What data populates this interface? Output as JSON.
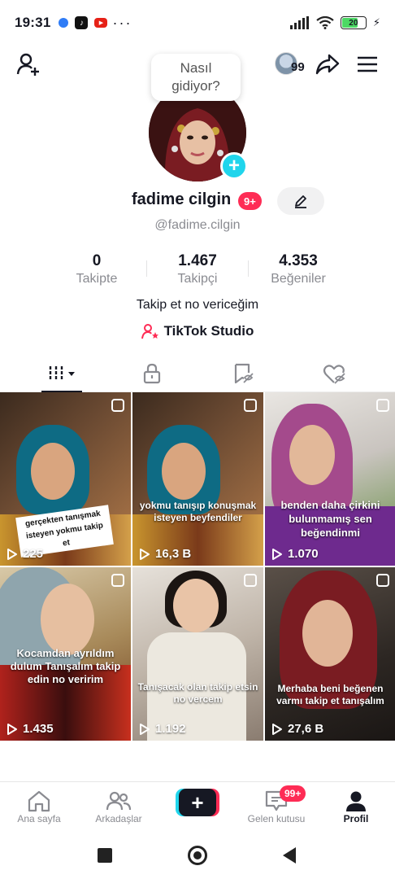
{
  "status_bar": {
    "time": "19:31",
    "dots": "···",
    "battery_level": "20",
    "colors": {
      "battery_fill": "#4cd964"
    }
  },
  "top_bar": {
    "visitor_count": "99",
    "icons": [
      "add-friend-icon",
      "share-icon",
      "menu-icon"
    ]
  },
  "avatar_bubble": {
    "line1": "Nasıl",
    "line2": "gidiyor?"
  },
  "profile": {
    "username": "fadime cilgin",
    "notification_badge": "9+",
    "handle": "@fadime.cilgin",
    "bio": "Takip et no vericeğim",
    "studio_label": "TikTok Studio"
  },
  "stats": [
    {
      "value": "0",
      "label": "Takipte"
    },
    {
      "value": "1.467",
      "label": "Takipçi"
    },
    {
      "value": "4.353",
      "label": "Beğeniler"
    }
  ],
  "tabs": [
    "videos-grid-icon",
    "private-lock-icon",
    "reposts-icon",
    "liked-icon"
  ],
  "videos": [
    {
      "views": "225",
      "caption": "gerçekten tanışmak isteyen yokmu takip et"
    },
    {
      "views": "16,3 B",
      "caption": "yokmu tanışıp konuşmak isteyen beyfendiler"
    },
    {
      "views": "1.070",
      "caption": "benden daha çirkini bulunmamış sen beğendinmi"
    },
    {
      "views": "1.435",
      "caption": "Kocamdan ayrıldım dulum Tanışalım takip edin no veririm"
    },
    {
      "views": "1.192",
      "caption": "Tanışacak olan takip etsin no vercem"
    },
    {
      "views": "27,6 B",
      "caption": "Merhaba beni beğenen varmı takip et tanışalım"
    }
  ],
  "bottom_nav": {
    "home": "Ana sayfa",
    "friends": "Arkadaşlar",
    "create": "+",
    "inbox": "Gelen kutusu",
    "inbox_badge": "99+",
    "profile": "Profil"
  },
  "colors": {
    "accent_red": "#fe2c55",
    "accent_cyan": "#20d5ec",
    "text_primary": "#161823",
    "text_secondary": "#8a8b91"
  }
}
